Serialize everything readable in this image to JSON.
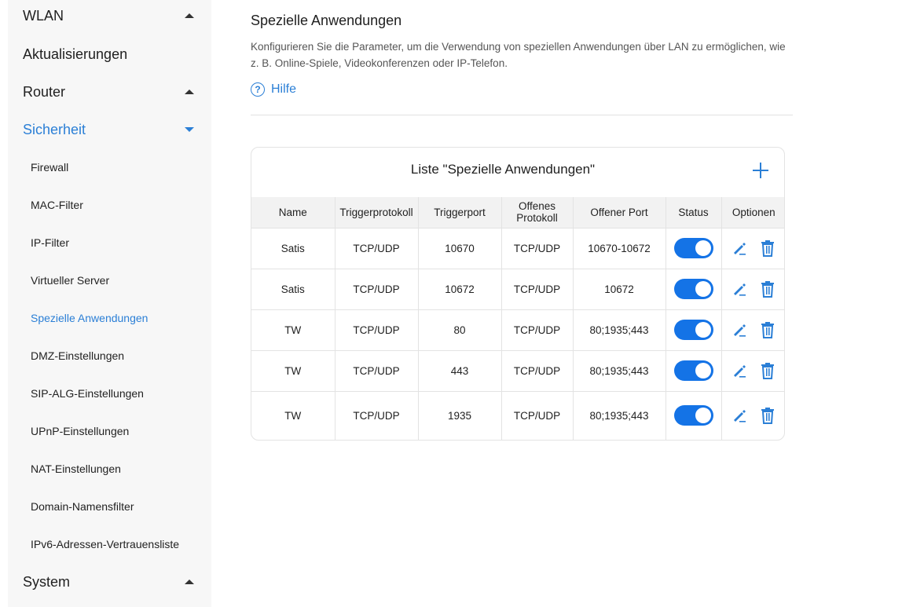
{
  "sidebar": {
    "top_items": [
      {
        "label": "WLAN"
      },
      {
        "label": "Aktualisierungen"
      },
      {
        "label": "Router"
      },
      {
        "label": "Sicherheit"
      },
      {
        "label": "System"
      }
    ],
    "sub_items": [
      {
        "label": "Firewall"
      },
      {
        "label": "MAC-Filter"
      },
      {
        "label": "IP-Filter"
      },
      {
        "label": "Virtueller Server"
      },
      {
        "label": "Spezielle Anwendungen"
      },
      {
        "label": "DMZ-Einstellungen"
      },
      {
        "label": "SIP-ALG-Einstellungen"
      },
      {
        "label": "UPnP-Einstellungen"
      },
      {
        "label": "NAT-Einstellungen"
      },
      {
        "label": "Domain-Namensfilter"
      },
      {
        "label": "IPv6-Adressen-Vertrauensliste"
      }
    ],
    "active_sub": "Spezielle Anwendungen",
    "accent_color": "#2b7fd6"
  },
  "main": {
    "title": "Spezielle Anwendungen",
    "description": "Konfigurieren Sie die Parameter, um die Verwendung von speziellen Anwendungen über LAN zu ermöglichen, wie z. B. Online-Spiele, Videokonferenzen oder IP-Telefon.",
    "help_icon": "?",
    "help_label": "Hilfe",
    "card_title": "Liste \"Spezielle Anwendungen\"",
    "columns": [
      "Name",
      "Triggerprotokoll",
      "Triggerport",
      "Offenes Protokoll",
      "Offener Port",
      "Status",
      "Optionen"
    ],
    "rows": [
      {
        "name": "Satis",
        "trigger_protocol": "TCP/UDP",
        "trigger_port": "10670",
        "open_protocol": "TCP/UDP",
        "open_port": "10670-10672",
        "status": "on"
      },
      {
        "name": "Satis",
        "trigger_protocol": "TCP/UDP",
        "trigger_port": "10672",
        "open_protocol": "TCP/UDP",
        "open_port": "10672",
        "status": "on"
      },
      {
        "name": "TW",
        "trigger_protocol": "TCP/UDP",
        "trigger_port": "80",
        "open_protocol": "TCP/UDP",
        "open_port": "80;1935;443",
        "status": "on"
      },
      {
        "name": "TW",
        "trigger_protocol": "TCP/UDP",
        "trigger_port": "443",
        "open_protocol": "TCP/UDP",
        "open_port": "80;1935;443",
        "status": "on"
      },
      {
        "name": "TW",
        "trigger_protocol": "TCP/UDP",
        "trigger_port": "1935",
        "open_protocol": "TCP/UDP",
        "open_port": "80;1935;443",
        "status": "on"
      }
    ],
    "icons": {
      "add": "plus-icon",
      "edit": "pencil-icon",
      "delete": "trash-icon"
    },
    "toggle_color": "#1473e6"
  }
}
